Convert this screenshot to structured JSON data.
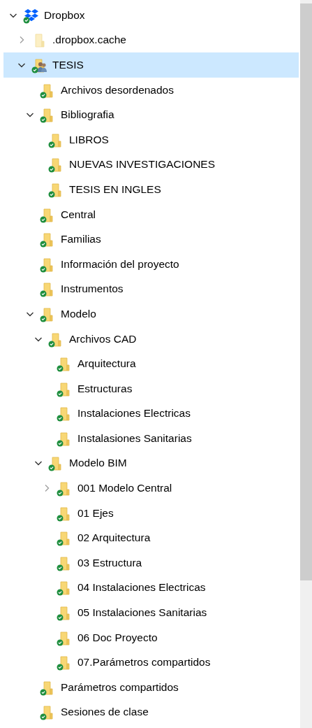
{
  "tree": [
    {
      "label": "Dropbox",
      "kind": "dropbox",
      "expanded": true,
      "selected": false,
      "children": [
        {
          "label": ".dropbox.cache",
          "kind": "folder",
          "expanded": false,
          "selected": false
        },
        {
          "label": "TESIS",
          "kind": "shared",
          "expanded": true,
          "selected": true,
          "children": [
            {
              "label": "Archivos desordenados",
              "kind": "synced",
              "selected": false
            },
            {
              "label": "Bibliografia",
              "kind": "synced",
              "expanded": true,
              "selected": false,
              "children": [
                {
                  "label": "LIBROS",
                  "kind": "synced",
                  "selected": false
                },
                {
                  "label": "NUEVAS INVESTIGACIONES",
                  "kind": "synced",
                  "selected": false
                },
                {
                  "label": "TESIS EN INGLES",
                  "kind": "synced",
                  "selected": false
                }
              ]
            },
            {
              "label": "Central",
              "kind": "synced",
              "selected": false
            },
            {
              "label": "Familias",
              "kind": "synced",
              "selected": false
            },
            {
              "label": "Información del proyecto",
              "kind": "synced",
              "selected": false
            },
            {
              "label": "Instrumentos",
              "kind": "synced",
              "selected": false
            },
            {
              "label": "Modelo",
              "kind": "synced",
              "expanded": true,
              "selected": false,
              "children": [
                {
                  "label": "Archivos CAD",
                  "kind": "synced",
                  "expanded": true,
                  "selected": false,
                  "children": [
                    {
                      "label": "Arquitectura",
                      "kind": "synced",
                      "selected": false
                    },
                    {
                      "label": "Estructuras",
                      "kind": "synced",
                      "selected": false
                    },
                    {
                      "label": "Instalaciones Electricas",
                      "kind": "synced",
                      "selected": false
                    },
                    {
                      "label": "Instalasiones Sanitarias",
                      "kind": "synced",
                      "selected": false
                    }
                  ]
                },
                {
                  "label": "Modelo BIM",
                  "kind": "synced",
                  "expanded": true,
                  "selected": false,
                  "children": [
                    {
                      "label": "001 Modelo Central",
                      "kind": "synced",
                      "expanded": false,
                      "selected": false
                    },
                    {
                      "label": "01 Ejes",
                      "kind": "synced",
                      "selected": false
                    },
                    {
                      "label": "02 Arquitectura",
                      "kind": "synced",
                      "selected": false
                    },
                    {
                      "label": "03 Estructura",
                      "kind": "synced",
                      "selected": false
                    },
                    {
                      "label": "04 Instalaciones Electricas",
                      "kind": "synced",
                      "selected": false
                    },
                    {
                      "label": "05 Instalaciones Sanitarias",
                      "kind": "synced",
                      "selected": false
                    },
                    {
                      "label": "06 Doc Proyecto",
                      "kind": "synced",
                      "selected": false
                    },
                    {
                      "label": "07.Parámetros compartidos",
                      "kind": "synced",
                      "selected": false
                    }
                  ]
                }
              ]
            },
            {
              "label": "Parámetros compartidos",
              "kind": "synced",
              "selected": false
            },
            {
              "label": "Sesiones de clase",
              "kind": "synced",
              "selected": false
            }
          ]
        }
      ]
    }
  ]
}
